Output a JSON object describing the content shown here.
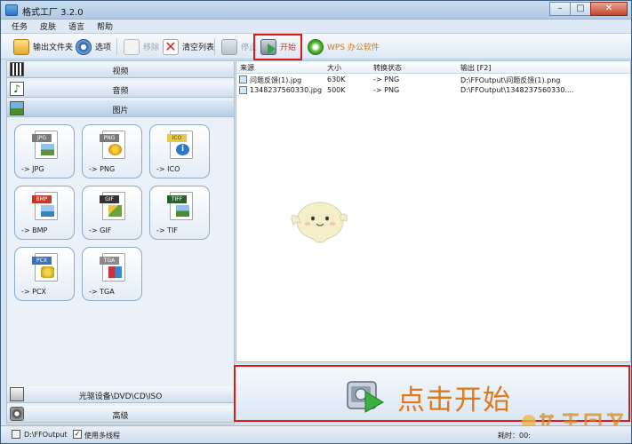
{
  "window": {
    "title": "格式工厂 3.2.0"
  },
  "menu": [
    "任务",
    "皮肤",
    "语言",
    "帮助"
  ],
  "toolbar": {
    "output_folder": "输出文件夹",
    "options": "选项",
    "remove": "移除",
    "clear_list": "清空列表",
    "stop": "停止",
    "start": "开始",
    "wps": "WPS 办公软件"
  },
  "categories": {
    "video": "视频",
    "audio": "音频",
    "image": "图片",
    "optical": "光驱设备\\DVD\\CD\\ISO",
    "advanced": "高级"
  },
  "tiles": [
    {
      "tag": "JPG",
      "label": "-> JPG",
      "color": "#5d8f3c"
    },
    {
      "tag": "PNG",
      "label": "-> PNG",
      "color": "#d88a1a"
    },
    {
      "tag": "ICO",
      "label": "-> ICO",
      "color": "#2f78c4"
    },
    {
      "tag": "BMP",
      "label": "-> BMP",
      "color": "#3b7fc0"
    },
    {
      "tag": "GIF",
      "label": "-> GIF",
      "color": "#6aa23b"
    },
    {
      "tag": "TIFF",
      "label": "-> TIF",
      "color": "#3c8cc7"
    },
    {
      "tag": "PCX",
      "label": "-> PCX",
      "color": "#c4a11f"
    },
    {
      "tag": "TGA",
      "label": "-> TGA",
      "color": "#c9343f"
    }
  ],
  "list": {
    "headers": {
      "source": "来源",
      "size": "大小",
      "status": "转换状态",
      "output": "输出 [F2]"
    },
    "rows": [
      {
        "source": "问题反馈(1).jpg",
        "size": "630K",
        "status": "-> PNG",
        "output": "D:\\FFOutput\\问题反馈(1).png"
      },
      {
        "source": "1348237560330.jpg",
        "size": "500K",
        "status": "-> PNG",
        "output": "D:\\FFOutput\\1348237560330...."
      }
    ]
  },
  "start_area": {
    "text": "点击开始"
  },
  "statusbar": {
    "path": "D:\\FFOutput",
    "multithread": "使用多线程",
    "multithread_checked": "✓",
    "time": "耗时：00:"
  },
  "colors": {
    "highlight": "#e01818",
    "start_text": "#e0791a"
  }
}
